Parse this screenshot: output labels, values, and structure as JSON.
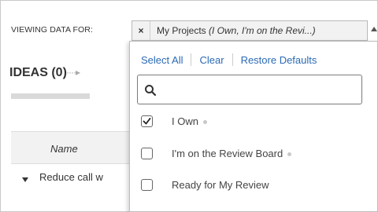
{
  "viewing": {
    "label": "VIEWING DATA FOR:",
    "selected_remove": "×",
    "selected_main": "My Projects ",
    "selected_italic": "(I Own, I'm on the Revi...)"
  },
  "ideas": {
    "title": "IDEAS (0)",
    "arrow": "····▸"
  },
  "table": {
    "columns": [
      "Name"
    ],
    "rows": [
      {
        "name": "Reduce call w"
      }
    ]
  },
  "dropdown": {
    "actions": {
      "select_all": "Select All",
      "clear": "Clear",
      "restore_defaults": "Restore Defaults"
    },
    "search": {
      "value": "",
      "placeholder": ""
    },
    "options": [
      {
        "label": "I Own",
        "checked": true,
        "has_dot": true
      },
      {
        "label": "I'm on the Review Board",
        "checked": false,
        "has_dot": true
      },
      {
        "label": "Ready for My Review",
        "checked": false,
        "has_dot": false
      }
    ]
  },
  "colors": {
    "link": "#2a6ab5",
    "tag_background": "#f2f2f2",
    "border": "#bdbdbd"
  },
  "icons": {
    "search": "search-icon",
    "check": "check-icon",
    "remove": "close-icon",
    "expand": "caret-down-icon"
  }
}
